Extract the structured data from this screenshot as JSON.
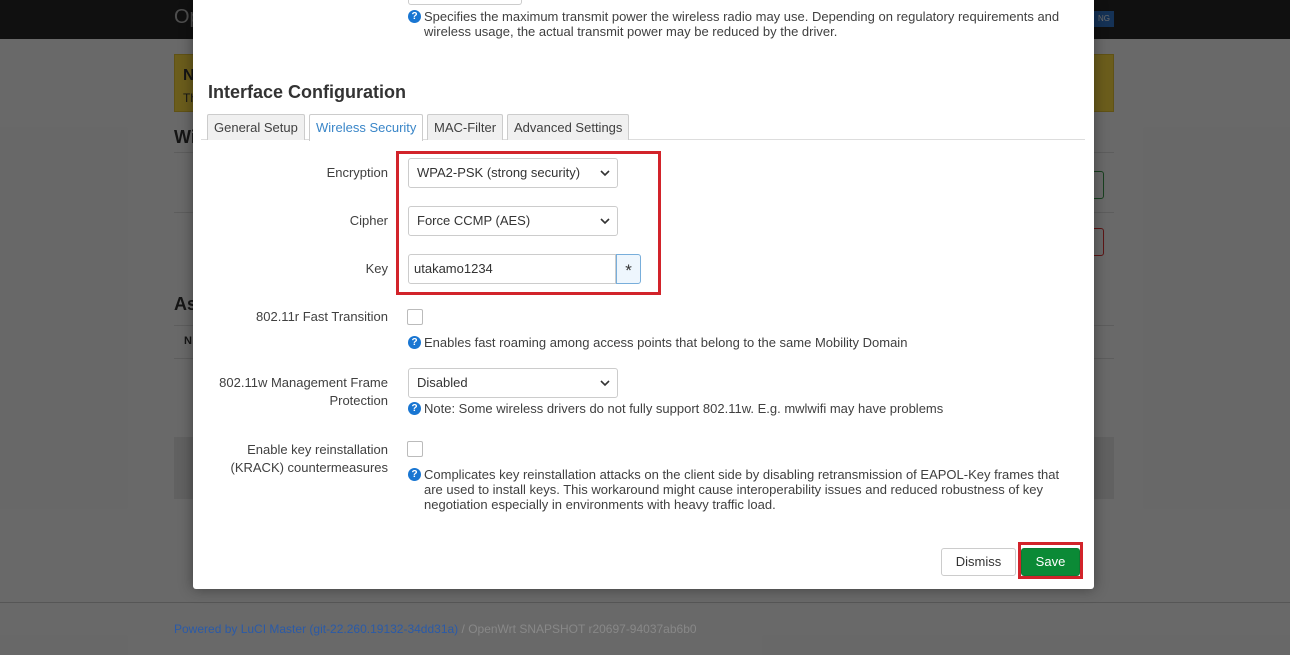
{
  "background": {
    "brand": "Op",
    "badge": "NG",
    "notice_title": "N",
    "notice_text": "Th",
    "heading_wireless": "Wi",
    "heading_associated": "As",
    "table_header": "N"
  },
  "modal": {
    "top_help": "Specifies the maximum transmit power the wireless radio may use. Depending on regulatory requirements and wireless usage, the actual transmit power may be reduced by the driver.",
    "section_title": "Interface Configuration",
    "tabs": [
      {
        "label": "General Setup"
      },
      {
        "label": "Wireless Security"
      },
      {
        "label": "MAC-Filter"
      },
      {
        "label": "Advanced Settings"
      }
    ],
    "encryption": {
      "label": "Encryption",
      "value": "WPA2-PSK (strong security)"
    },
    "cipher": {
      "label": "Cipher",
      "value": "Force CCMP (AES)"
    },
    "key": {
      "label": "Key",
      "value": "utakamo1234",
      "toggle": "*"
    },
    "fast_transition": {
      "label": "802.11r Fast Transition",
      "help": "Enables fast roaming among access points that belong to the same Mobility Domain"
    },
    "mgmt_protection": {
      "label_line1": "802.11w Management Frame",
      "label_line2": "Protection",
      "value": "Disabled",
      "help": "Note: Some wireless drivers do not fully support 802.11w. E.g. mwlwifi may have problems"
    },
    "krack": {
      "label_line1": "Enable key reinstallation",
      "label_line2": "(KRACK) countermeasures",
      "help": "Complicates key reinstallation attacks on the client side by disabling retransmission of EAPOL-Key frames that are used to install keys. This workaround might cause interoperability issues and reduced robustness of key negotiation especially in environments with heavy traffic load."
    },
    "dismiss_label": "Dismiss",
    "save_label": "Save"
  },
  "footer": {
    "link": "Powered by LuCI Master (git-22.260.19132-34dd31a)",
    "text": " / OpenWrt SNAPSHOT r20697-94037ab6b0"
  },
  "colors": {
    "accent": "#3a86c8",
    "save": "#0b8a36",
    "highlight": "#d2232a"
  }
}
